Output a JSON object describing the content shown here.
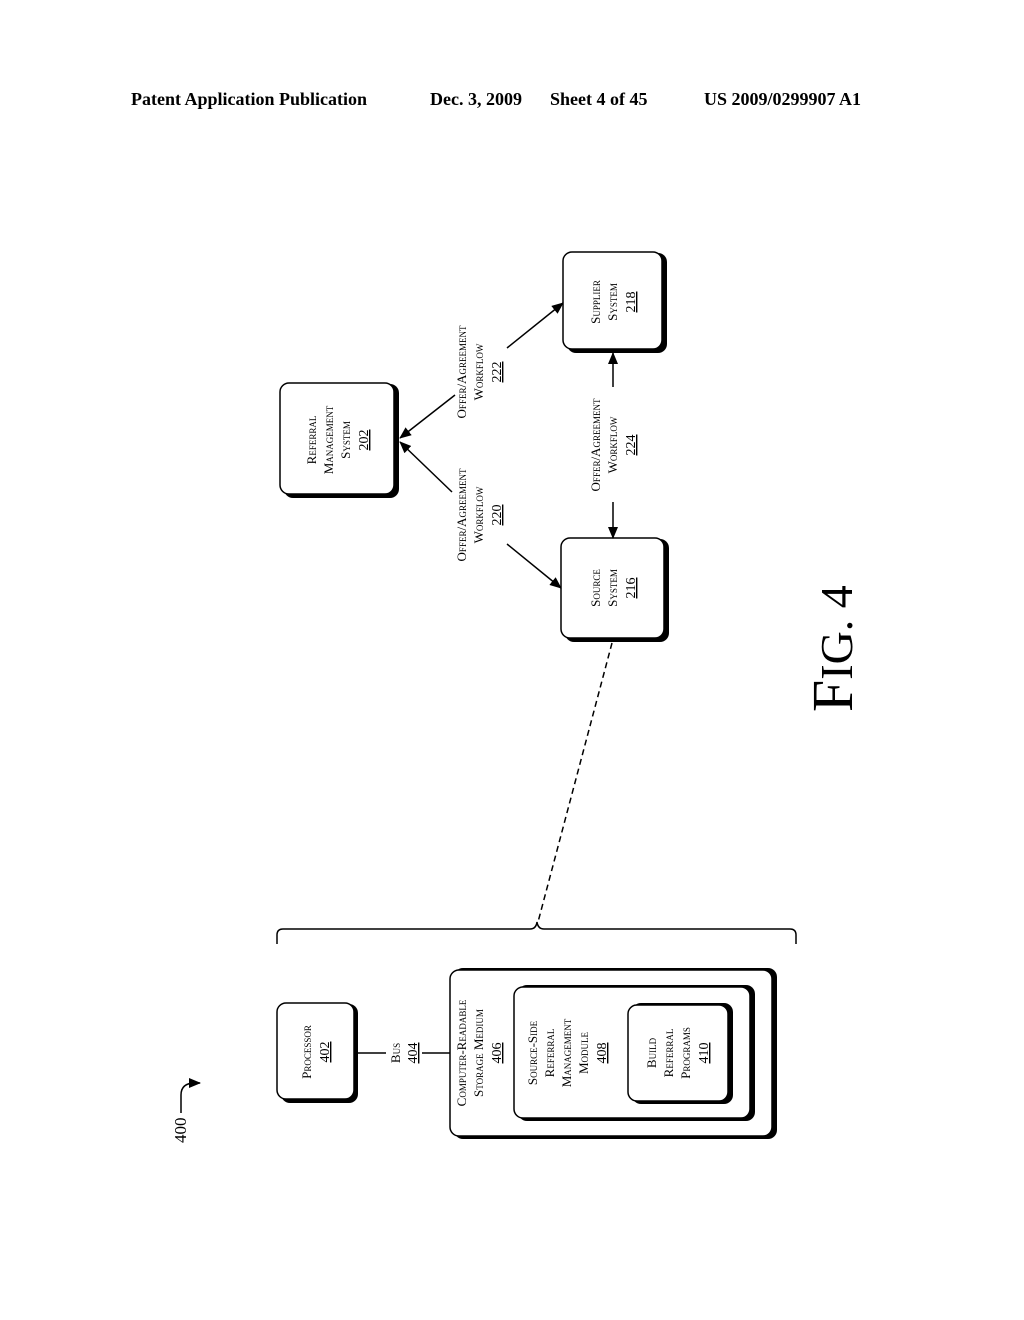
{
  "header": {
    "left": "Patent Application Publication",
    "date": "Dec. 3, 2009",
    "sheet": "Sheet 4 of 45",
    "pub_number": "US 2009/0299907 A1"
  },
  "figure": {
    "label_f": "F",
    "label_rest": "IG. 4",
    "reference": "400"
  },
  "nodes": {
    "referral": {
      "lines": [
        "Referral",
        "Management",
        "System"
      ],
      "number": "202"
    },
    "supplier": {
      "lines": [
        "Supplier",
        "System"
      ],
      "number": "218"
    },
    "source": {
      "lines": [
        "Source",
        "System"
      ],
      "number": "216"
    },
    "processor": {
      "lines": [
        "Processor"
      ],
      "number": "402"
    },
    "bus": {
      "lines": [
        "Bus"
      ],
      "number": "404"
    },
    "storage": {
      "lines": [
        "Computer-Readable",
        "Storage Medium"
      ],
      "number": "406"
    },
    "module": {
      "lines": [
        "Source-Side",
        "Referral",
        "Management",
        "Module"
      ],
      "number": "408"
    },
    "build": {
      "lines": [
        "Build",
        "Referral",
        "Programs"
      ],
      "number": "410"
    }
  },
  "edges": {
    "wf220": {
      "lines": [
        "Offer/Agreement",
        "Workflow"
      ],
      "number": "220"
    },
    "wf222": {
      "lines": [
        "Offer/Agreement",
        "Workflow"
      ],
      "number": "222"
    },
    "wf224": {
      "lines": [
        "Offer/Agreement",
        "Workflow"
      ],
      "number": "224"
    }
  }
}
